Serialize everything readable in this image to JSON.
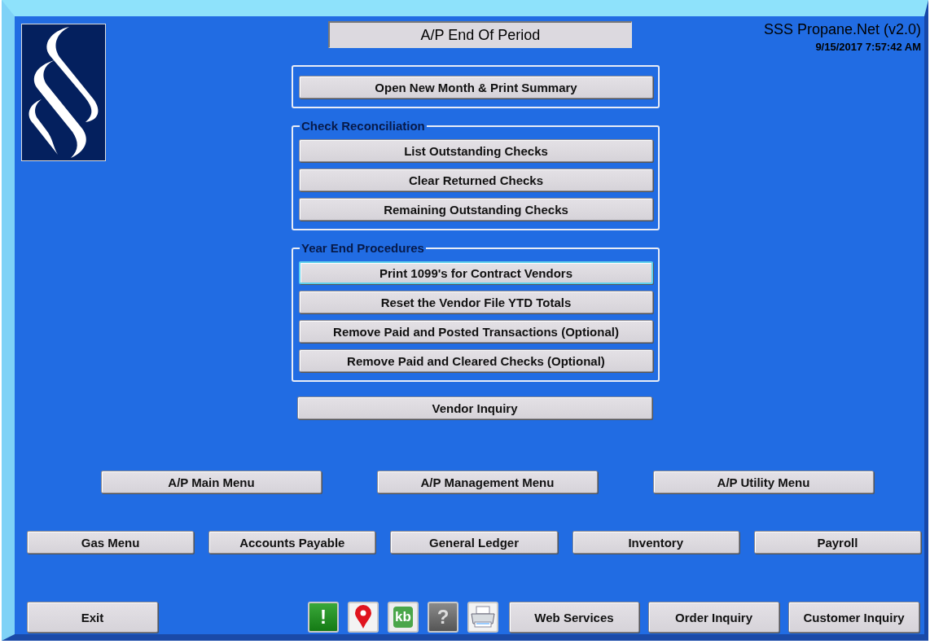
{
  "title": "A/P End Of Period",
  "header": {
    "app": "SSS Propane.Net (v2.0)",
    "datetime": "9/15/2017 7:57:42 AM"
  },
  "groups": [
    {
      "buttons": [
        {
          "label": "Open New Month & Print Summary",
          "focused": false
        }
      ]
    },
    {
      "label": "Check Reconciliation",
      "buttons": [
        {
          "label": "List Outstanding Checks",
          "focused": false
        },
        {
          "label": "Clear Returned Checks",
          "focused": false
        },
        {
          "label": "Remaining Outstanding Checks",
          "focused": false
        }
      ]
    },
    {
      "label": "Year End Procedures",
      "buttons": [
        {
          "label": "Print 1099's for Contract Vendors",
          "focused": true
        },
        {
          "label": "Reset the Vendor File YTD Totals",
          "focused": false
        },
        {
          "label": "Remove Paid and Posted Transactions  (Optional)",
          "focused": false
        },
        {
          "label": "Remove Paid and Cleared Checks  (Optional)",
          "focused": false
        }
      ]
    }
  ],
  "vendor_inquiry": "Vendor Inquiry",
  "menu_buttons": [
    "A/P Main Menu",
    "A/P Management Menu",
    "A/P Utility Menu"
  ],
  "nav_buttons": [
    "Gas Menu",
    "Accounts Payable",
    "General Ledger",
    "Inventory",
    "Payroll"
  ],
  "exit": "Exit",
  "toolbar_icons": [
    {
      "kind": "alert",
      "glyph": "!"
    },
    {
      "kind": "pin"
    },
    {
      "kind": "kb",
      "glyph": "kb"
    },
    {
      "kind": "help",
      "glyph": "?"
    },
    {
      "kind": "printer"
    }
  ],
  "bottom_buttons": [
    "Web Services",
    "Order Inquiry",
    "Customer Inquiry"
  ]
}
